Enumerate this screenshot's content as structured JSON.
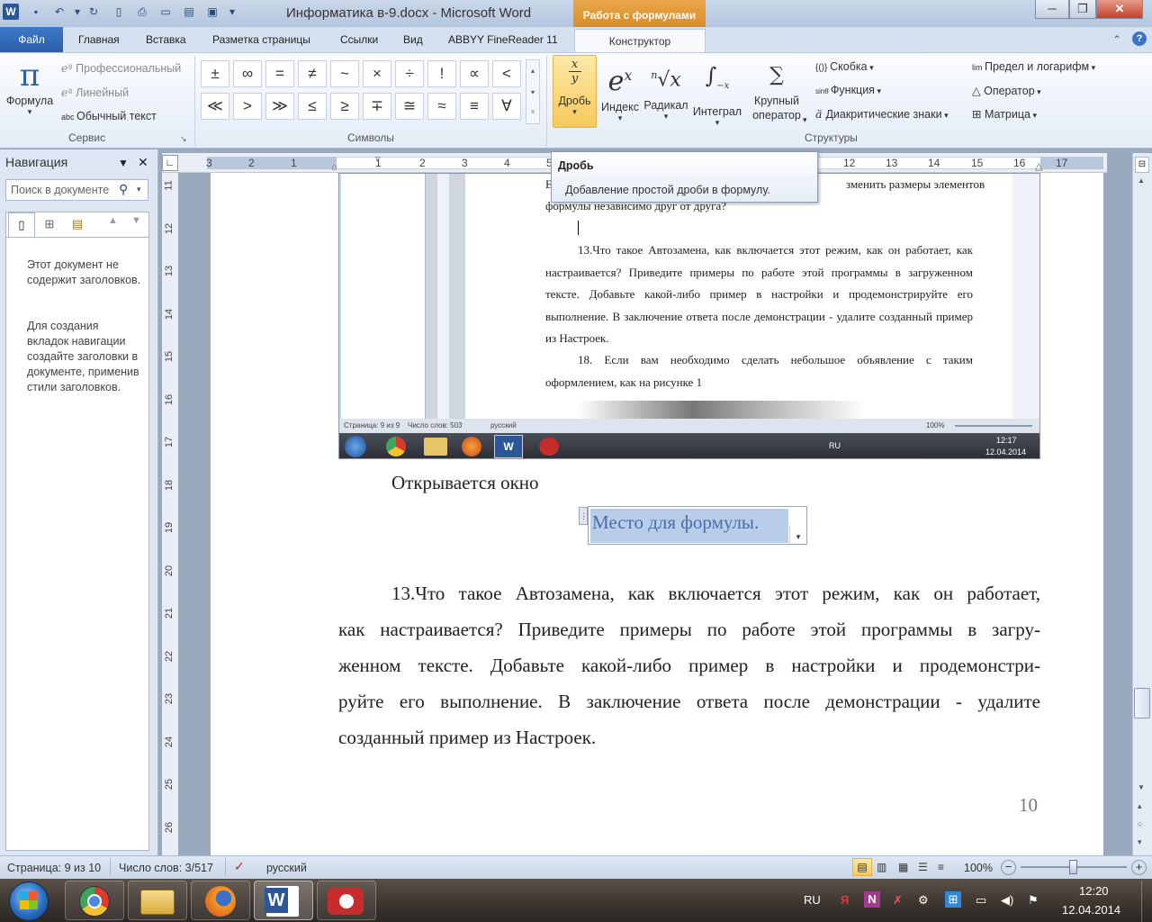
{
  "window": {
    "title": "Информатика в-9.docx  -  Microsoft Word",
    "context_tab_header": "Работа с формулами",
    "buttons": {
      "minimize": "─",
      "restore": "❐",
      "close": "✕"
    }
  },
  "ribbon_tabs": [
    "Файл",
    "Главная",
    "Вставка",
    "Разметка страницы",
    "Ссылки",
    "Вид",
    "ABBYY FineReader 11",
    "Конструктор"
  ],
  "ribbon": {
    "service": {
      "formula_label": "Формула",
      "professional": "Профессиональный",
      "linear": "Линейный",
      "plain_text": "Обычный текст",
      "group_label": "Сервис"
    },
    "symbols": {
      "row1": [
        "±",
        "∞",
        "=",
        "≠",
        "~",
        "×",
        "÷",
        "!",
        "∝",
        "<"
      ],
      "row2": [
        "≪",
        ">",
        "≫",
        "≤",
        "≥",
        "∓",
        "≅",
        "≈",
        "≡",
        "∀"
      ],
      "group_label": "Символы"
    },
    "structures": {
      "fraction": "Дробь",
      "index": "Индекс",
      "radical": "Радикал",
      "integral": "Интеграл",
      "large_operator_1": "Крупный",
      "large_operator_2": "оператор",
      "bracket": "Скобка",
      "function": "Функция",
      "diacritics": "Диакритические знаки",
      "limit_log": "Предел и логарифм",
      "operator": "Оператор",
      "matrix": "Матрица",
      "group_label": "Структуры"
    }
  },
  "tooltip": {
    "title": "Дробь",
    "text": "Добавление простой дроби в формулу."
  },
  "navigation": {
    "title": "Навигация",
    "search_placeholder": "Поиск в документе",
    "message1": "Этот документ не содержит заголовков.",
    "message2": "Для создания вкладок навигации создайте заголовки в документе, применив стили заголовков."
  },
  "ruler": {
    "h_ticks": [
      "3",
      "2",
      "1",
      "1",
      "2",
      "3",
      "4",
      "5",
      "12",
      "13",
      "14",
      "15",
      "16",
      "17"
    ],
    "v_ticks": [
      "11",
      "12",
      "13",
      "14",
      "15",
      "16",
      "17",
      "18",
      "19",
      "20",
      "21",
      "22",
      "23",
      "24",
      "25",
      "26"
    ]
  },
  "screenshot": {
    "line0a": "В",
    "line0b": "зменить размеры элементов",
    "line1": "формулы независимо друг от друга?",
    "para1": "13.Что такое Автозамена, как включается этот режим, как он работает, как настраивается? Приведите примеры по работе этой программы в загруженном тексте. Добавьте какой-либо пример в настройки и продемонстрируйте его выполнение. В заключение ответа после демонстрации - удалите созданный пример из Настроек.",
    "para2": "18. Если вам необходимо сделать небольшое объявление с таким оформлением, как на рисунке 1",
    "status_page": "Страница: 9 из 9",
    "status_words": "Число слов: 503",
    "status_lang": "русский",
    "status_zoom": "100%",
    "tray_lang": "RU",
    "tray_time": "12:17",
    "tray_date": "12.04.2014"
  },
  "document": {
    "opens_window": "Открывается окно",
    "formula_placeholder": "Место для формулы.",
    "p_line1": "13.Что такое Автозамена, как включается этот режим, как он работает,",
    "p_line2": "как настраивается? Приведите примеры по работе этой программы в загру-",
    "p_line3": "женном тексте. Добавьте какой-либо пример в настройки и продемонстри-",
    "p_line4": "руйте его выполнение. В заключение ответа после демонстрации - удалите",
    "p_line5": "созданный пример из Настроек.",
    "page_number": "10"
  },
  "statusbar": {
    "page": "Страница: 9 из 10",
    "words": "Число слов: 3/517",
    "language": "русский",
    "zoom": "100%"
  },
  "taskbar": {
    "lang": "RU",
    "time": "12:20",
    "date": "12.04.2014"
  }
}
